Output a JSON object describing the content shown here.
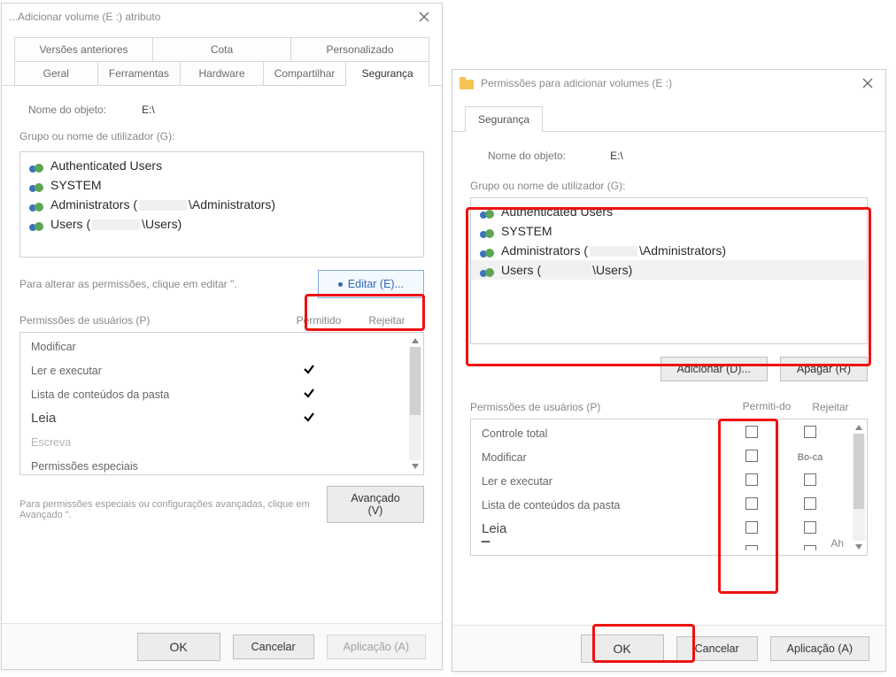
{
  "left": {
    "title": "...Adicionar volume (E :) atributo",
    "tabsTop": [
      "Versões anteriores",
      "Cota",
      "Personalizado"
    ],
    "tabsBottom": [
      "Geral",
      "Ferramentas",
      "Hardware",
      "Compartilhar",
      "Segurança"
    ],
    "activeTab": "Segurança",
    "objectLabel": "Nome do objeto:",
    "objectValue": "E:\\",
    "groupsLabel": "Grupo ou nome de utilizador (G):",
    "users": {
      "u0": "Authenticated Users",
      "u1": "SYSTEM",
      "u2_pre": "Administrators (",
      "u2_post": "\\Administrators)",
      "u3_pre": "Users (",
      "u3_post": "\\Users)"
    },
    "editHint": "Para alterar as permissões, clique em editar \".",
    "editBtn": "Editar (E)...",
    "permLabel": "Permissões de usuários (P)",
    "colAllow": "Permitido",
    "colDeny": "Rejeitar",
    "perms": {
      "p0": "Modificar",
      "p1": "Ler e executar",
      "p2": "Lista de conteúdos da pasta",
      "p3": "Leia",
      "p4": "Escreva",
      "p5": "Permissões especiais"
    },
    "advText": "Para permissões especiais ou configurações avançadas, clique em Avançado \".",
    "advBtn": "Avançado (V)",
    "footer": {
      "ok": "OK",
      "cancel": "Cancelar",
      "apply": "Aplicação (A)"
    }
  },
  "right": {
    "title": "Permissões para adicionar volumes (E :)",
    "tab": "Segurança",
    "objectLabel": "Nome do objeto:",
    "objectValue": "E:\\",
    "groupsLabel": "Grupo ou nome de utilizador (G):",
    "users": {
      "u0": "Authenticated Users",
      "u1": "SYSTEM",
      "u2_pre": "Administrators (",
      "u2_post": "\\Administrators)",
      "u3_pre": "Users (",
      "u3_post": "\\Users)"
    },
    "addBtn": "Adicionar (D)...",
    "removeBtn": "Apagar (R)",
    "permLabel": "Permissões de usuários (P)",
    "colAllow": "Permiti-do",
    "colDeny": "Rejeitar",
    "perms": {
      "p0": "Controle total",
      "p1": "Modificar",
      "p2": "Ler e executar",
      "p3": "Lista de conteúdos da pasta",
      "p4": "Leia"
    },
    "denyWord": "Bo-ca",
    "ahWord": "Ah",
    "footer": {
      "ok": "OK",
      "cancel": "Cancelar",
      "apply": "Aplicação (A)"
    }
  }
}
